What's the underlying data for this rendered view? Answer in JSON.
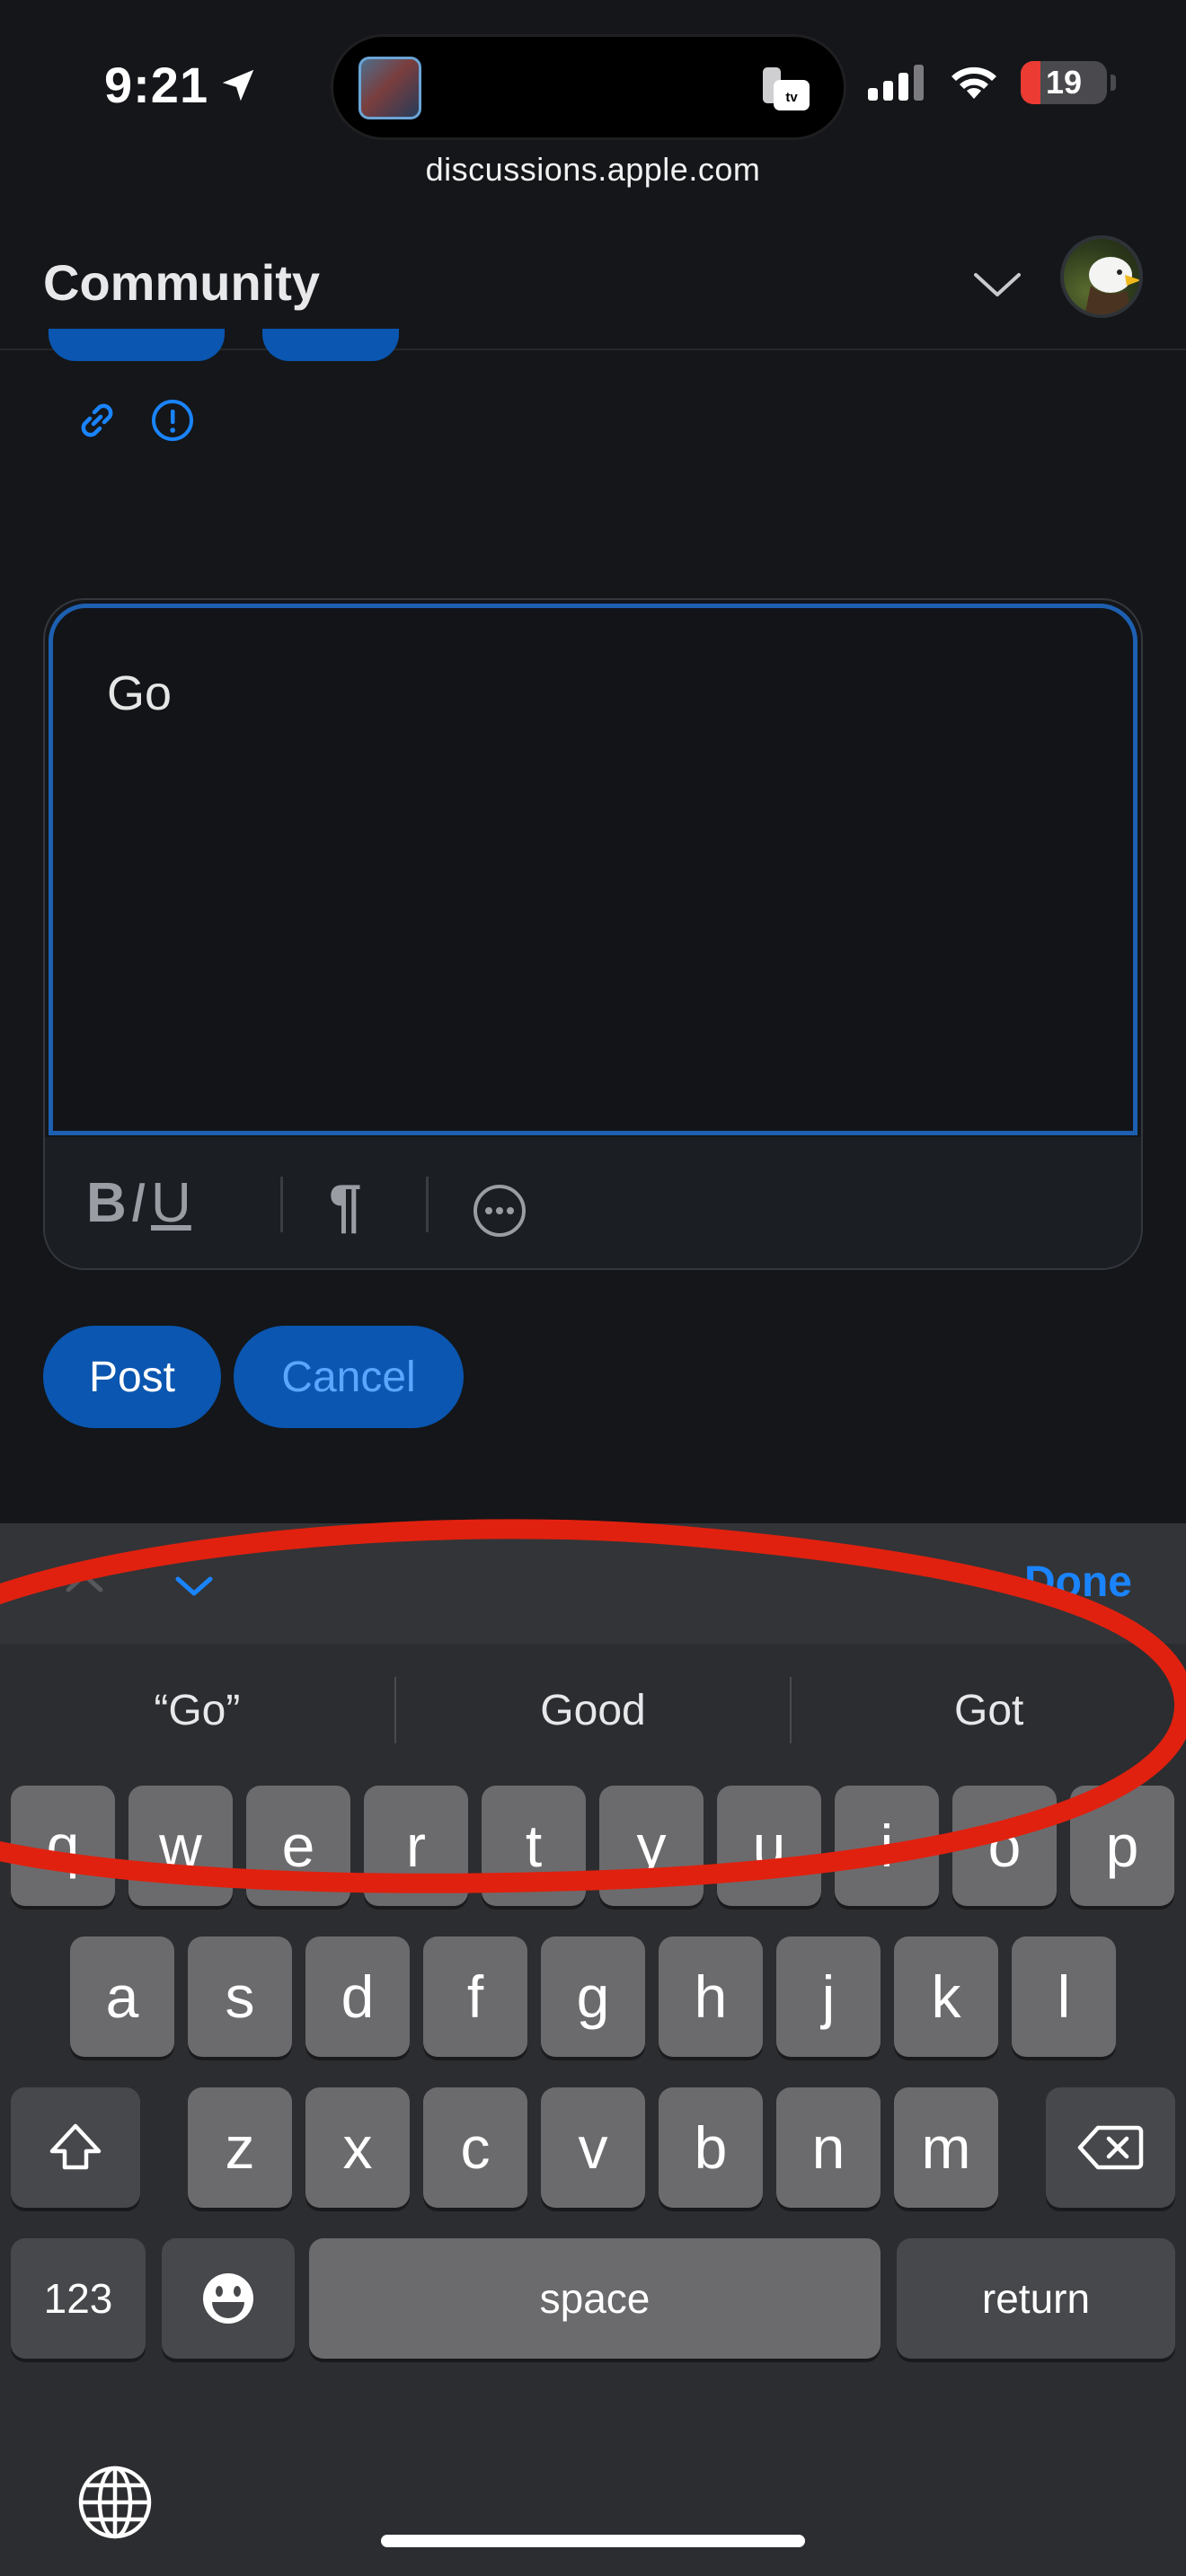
{
  "status_bar": {
    "time": "9:21",
    "battery": "19",
    "url": "discussions.apple.com"
  },
  "header": {
    "title": "Community"
  },
  "editor": {
    "text": "Go",
    "toolbar": {
      "bold": "B",
      "italic": "I",
      "underline": "U",
      "paragraph": "¶"
    }
  },
  "buttons": {
    "post": "Post",
    "cancel": "Cancel"
  },
  "keyboard": {
    "done": "Done",
    "suggestions": [
      "“Go”",
      "Good",
      "Got"
    ],
    "row1": [
      "q",
      "w",
      "e",
      "r",
      "t",
      "y",
      "u",
      "i",
      "o",
      "p"
    ],
    "row2": [
      "a",
      "s",
      "d",
      "f",
      "g",
      "h",
      "j",
      "k",
      "l"
    ],
    "row3": [
      "z",
      "x",
      "c",
      "v",
      "b",
      "n",
      "m"
    ],
    "numbers_key": "123",
    "space_key": "space",
    "return_key": "return"
  },
  "colors": {
    "accent": "#0a56b0",
    "link": "#1a84ff",
    "annotation": "#e0210f"
  },
  "icons": [
    "location-arrow-icon",
    "apple-tv-icon",
    "signal-icon",
    "wifi-icon",
    "battery-icon",
    "chevron-down-icon",
    "link-icon",
    "report-icon",
    "more-icon",
    "shift-icon",
    "delete-icon",
    "emoji-icon",
    "globe-icon"
  ]
}
